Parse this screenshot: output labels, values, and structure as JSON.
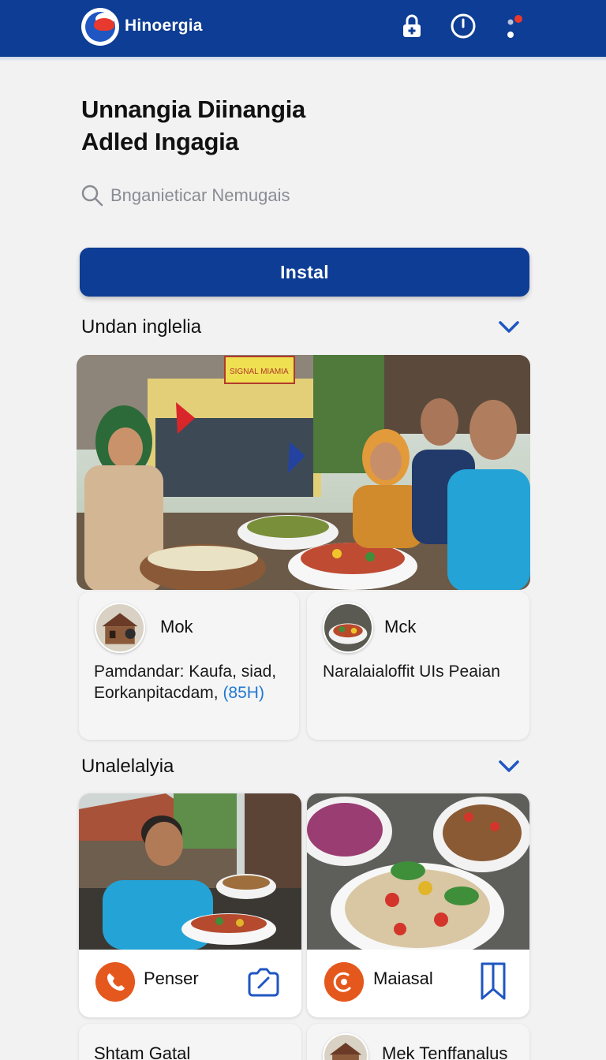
{
  "app": {
    "brand": "Hinoergia"
  },
  "header": {
    "headline_line1": "Unnangia Diinangia",
    "headline_line2": "Adled Ingagia"
  },
  "search": {
    "placeholder": "Bnganieticar Nemugais"
  },
  "install_button": {
    "label": "Instal"
  },
  "section1": {
    "title": "Undan inglelia",
    "hero_sign": "SIGNAL MIAMIA",
    "cards": [
      {
        "title": "Mok",
        "text_line1": "Pamdandar: Kaufa, siad,",
        "text_line2": "Eorkanpitacdam,",
        "text_highlight": "(85H)"
      },
      {
        "title": "Mck",
        "text_line1": "Naralaialoffit UIs Peaian"
      }
    ]
  },
  "section2": {
    "title": "Unalelalyia",
    "cards": [
      {
        "label": "Penser",
        "action_icon": "share-icon"
      },
      {
        "label": "Maiasal",
        "action_icon": "bookmark-icon"
      }
    ],
    "partial_cards": [
      {
        "title": "Shtam Gatal"
      },
      {
        "title": "Mek Tenffanalus"
      }
    ]
  },
  "colors": {
    "brand_blue": "#0d3d94",
    "accent_orange": "#e5581d",
    "link_blue": "#1f78d1",
    "logo_red": "#e8392f"
  }
}
